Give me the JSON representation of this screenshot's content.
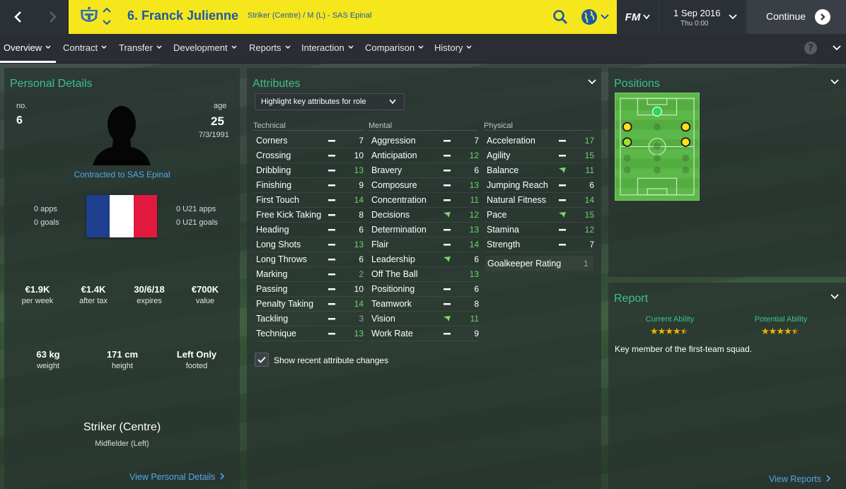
{
  "header": {
    "player_title": "6. Franck Julienne",
    "player_subtitle": "Striker (Centre) / M (L) - SAS Epinal",
    "date": "1 Sep 2016",
    "time": "Thu 0:00",
    "continue_label": "Continue",
    "fm_label": "FM",
    "accent_color": "#f6e61c"
  },
  "tabs": [
    {
      "label": "Overview"
    },
    {
      "label": "Contract"
    },
    {
      "label": "Transfer"
    },
    {
      "label": "Development"
    },
    {
      "label": "Reports"
    },
    {
      "label": "Interaction"
    },
    {
      "label": "Comparison"
    },
    {
      "label": "History"
    }
  ],
  "help_label": "?",
  "personal": {
    "title": "Personal Details",
    "no_label": "no.",
    "no_value": "6",
    "age_label": "age",
    "age_value": "25",
    "dob": "7/3/1991",
    "contract_text": "Contracted to SAS Epinal",
    "apps": "0 apps",
    "goals": "0 goals",
    "u21_apps": "0 U21 apps",
    "u21_goals": "0 U21 goals",
    "wage": "€1.9K",
    "wage_label": "per week",
    "after_tax": "€1.4K",
    "after_tax_label": "after tax",
    "expires": "30/6/18",
    "expires_label": "expires",
    "value": "€700K",
    "value_label": "value",
    "weight": "63 kg",
    "weight_label": "weight",
    "height": "171 cm",
    "height_label": "height",
    "foot": "Left Only",
    "foot_label": "footed",
    "main_position": "Striker (Centre)",
    "secondary_position": "Midfielder (Left)",
    "view_link": "View Personal Details",
    "flag_colors": [
      "#1f3f8f",
      "#ffffff",
      "#e2193f"
    ]
  },
  "attributes": {
    "title": "Attributes",
    "highlight_label": "Highlight key attributes for role",
    "show_changes_label": "Show recent attribute changes",
    "high_color": "#6fd36f",
    "low_color": "#9aa0a6",
    "technical": {
      "label": "Technical",
      "items": [
        {
          "name": "Corners",
          "value": "7",
          "trend": "flat",
          "tier": "normal"
        },
        {
          "name": "Crossing",
          "value": "10",
          "trend": "flat",
          "tier": "normal"
        },
        {
          "name": "Dribbling",
          "value": "13",
          "trend": "flat",
          "tier": "high"
        },
        {
          "name": "Finishing",
          "value": "9",
          "trend": "flat",
          "tier": "normal"
        },
        {
          "name": "First Touch",
          "value": "14",
          "trend": "flat",
          "tier": "high"
        },
        {
          "name": "Free Kick Taking",
          "value": "8",
          "trend": "flat",
          "tier": "normal"
        },
        {
          "name": "Heading",
          "value": "6",
          "trend": "flat",
          "tier": "normal"
        },
        {
          "name": "Long Shots",
          "value": "13",
          "trend": "flat",
          "tier": "high"
        },
        {
          "name": "Long Throws",
          "value": "6",
          "trend": "flat",
          "tier": "normal"
        },
        {
          "name": "Marking",
          "value": "2",
          "trend": "flat",
          "tier": "low"
        },
        {
          "name": "Passing",
          "value": "10",
          "trend": "flat",
          "tier": "normal"
        },
        {
          "name": "Penalty Taking",
          "value": "14",
          "trend": "flat",
          "tier": "high"
        },
        {
          "name": "Tackling",
          "value": "3",
          "trend": "flat",
          "tier": "low"
        },
        {
          "name": "Technique",
          "value": "13",
          "trend": "flat",
          "tier": "high"
        }
      ]
    },
    "mental": {
      "label": "Mental",
      "items": [
        {
          "name": "Aggression",
          "value": "7",
          "trend": "flat",
          "tier": "normal"
        },
        {
          "name": "Anticipation",
          "value": "12",
          "trend": "flat",
          "tier": "high"
        },
        {
          "name": "Bravery",
          "value": "6",
          "trend": "flat",
          "tier": "normal"
        },
        {
          "name": "Composure",
          "value": "13",
          "trend": "flat",
          "tier": "high"
        },
        {
          "name": "Concentration",
          "value": "11",
          "trend": "flat",
          "tier": "high"
        },
        {
          "name": "Decisions",
          "value": "12",
          "trend": "up",
          "tier": "high"
        },
        {
          "name": "Determination",
          "value": "13",
          "trend": "flat",
          "tier": "high"
        },
        {
          "name": "Flair",
          "value": "14",
          "trend": "flat",
          "tier": "high"
        },
        {
          "name": "Leadership",
          "value": "6",
          "trend": "up",
          "tier": "normal"
        },
        {
          "name": "Off The Ball",
          "value": "13",
          "trend": "none",
          "tier": "high"
        },
        {
          "name": "Positioning",
          "value": "6",
          "trend": "flat",
          "tier": "normal"
        },
        {
          "name": "Teamwork",
          "value": "8",
          "trend": "flat",
          "tier": "normal"
        },
        {
          "name": "Vision",
          "value": "11",
          "trend": "up",
          "tier": "high"
        },
        {
          "name": "Work Rate",
          "value": "9",
          "trend": "flat",
          "tier": "normal"
        }
      ]
    },
    "physical": {
      "label": "Physical",
      "items": [
        {
          "name": "Acceleration",
          "value": "17",
          "trend": "flat",
          "tier": "high"
        },
        {
          "name": "Agility",
          "value": "15",
          "trend": "flat",
          "tier": "high"
        },
        {
          "name": "Balance",
          "value": "11",
          "trend": "up",
          "tier": "high"
        },
        {
          "name": "Jumping Reach",
          "value": "6",
          "trend": "flat",
          "tier": "normal"
        },
        {
          "name": "Natural Fitness",
          "value": "14",
          "trend": "flat",
          "tier": "high"
        },
        {
          "name": "Pace",
          "value": "15",
          "trend": "up",
          "tier": "high"
        },
        {
          "name": "Stamina",
          "value": "12",
          "trend": "flat",
          "tier": "high"
        },
        {
          "name": "Strength",
          "value": "7",
          "trend": "flat",
          "tier": "normal"
        }
      ],
      "gk_label": "Goalkeeper Rating",
      "gk_value": "1"
    }
  },
  "positions": {
    "title": "Positions"
  },
  "report": {
    "title": "Report",
    "current_ability_label": "Current Ability",
    "current_ability_stars": 4.5,
    "potential_ability_label": "Potential Ability",
    "potential_ability_stars": 4.5,
    "summary": "Key member of the first-team squad.",
    "view_link": "View Reports"
  }
}
